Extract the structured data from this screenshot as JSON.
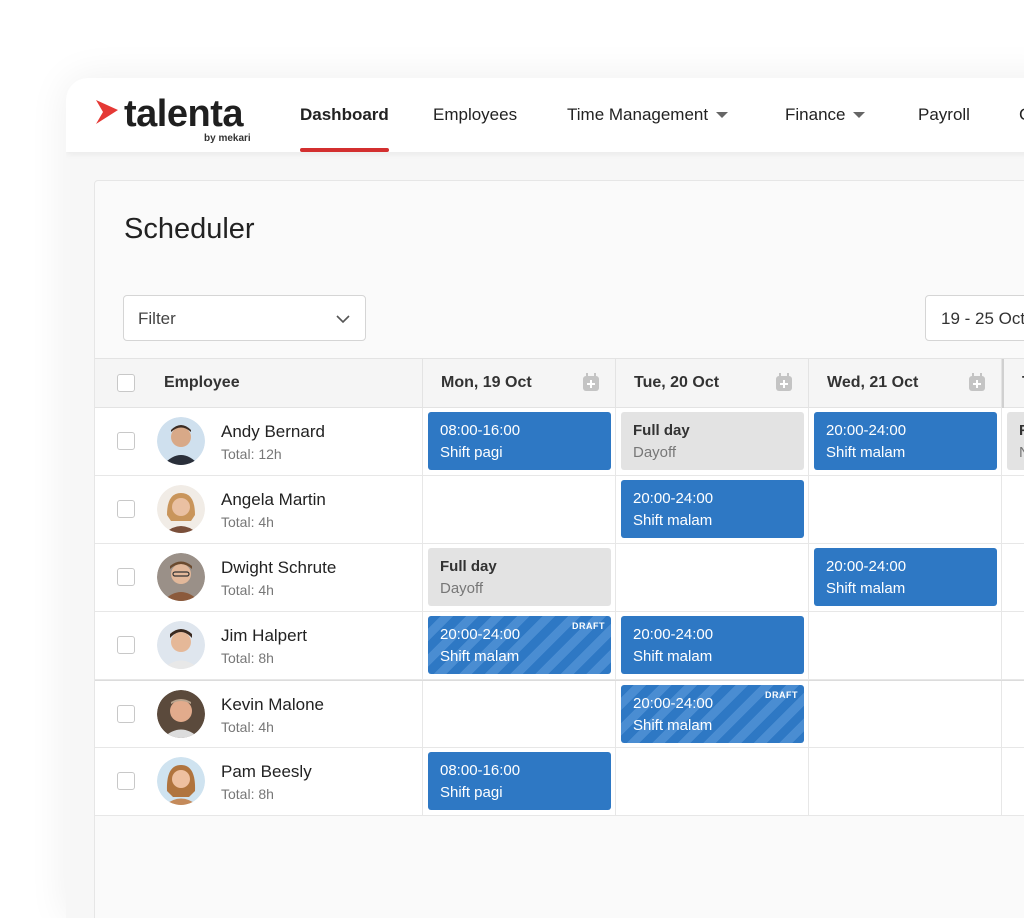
{
  "brand": {
    "name": "talenta",
    "sub": "by mekari",
    "accent": "#d32f2f"
  },
  "nav": {
    "dashboard": "Dashboard",
    "employees": "Employees",
    "time_management": "Time Management",
    "finance": "Finance",
    "payroll": "Payroll",
    "next_partial": "C"
  },
  "page": {
    "title": "Scheduler"
  },
  "filter": {
    "label": "Filter"
  },
  "date_range": {
    "label": "19 - 25 Oct"
  },
  "table": {
    "employee_header": "Employee",
    "days": [
      "Mon, 19 Oct",
      "Tue, 20 Oct",
      "Wed, 21 Oct",
      "T"
    ],
    "rows": [
      {
        "name": "Andy Bernard",
        "total": "Total: 12h",
        "mon": {
          "time": "08:00-16:00",
          "shift": "Shift pagi"
        },
        "tue": {
          "time": "Full day",
          "shift": "Dayoff"
        },
        "wed": {
          "time": "20:00-24:00",
          "shift": "Shift malam"
        },
        "thu": {
          "time": "F",
          "shift": "N"
        }
      },
      {
        "name": "Angela Martin",
        "total": "Total: 4h",
        "tue": {
          "time": "20:00-24:00",
          "shift": "Shift malam"
        }
      },
      {
        "name": "Dwight Schrute",
        "total": "Total: 4h",
        "mon": {
          "time": "Full day",
          "shift": "Dayoff"
        },
        "wed": {
          "time": "20:00-24:00",
          "shift": "Shift malam"
        }
      },
      {
        "name": "Jim Halpert",
        "total": "Total: 8h",
        "mon": {
          "time": "20:00-24:00",
          "shift": "Shift malam",
          "badge": "DRAFT"
        },
        "tue": {
          "time": "20:00-24:00",
          "shift": "Shift malam"
        }
      },
      {
        "name": "Kevin Malone",
        "total": "Total: 4h",
        "tue": {
          "time": "20:00-24:00",
          "shift": "Shift malam",
          "badge": "DRAFT"
        }
      },
      {
        "name": "Pam Beesly",
        "total": "Total: 8h",
        "mon": {
          "time": "08:00-16:00",
          "shift": "Shift pagi"
        }
      }
    ]
  },
  "colors": {
    "shift_blue": "#2e78c4",
    "dayoff_gray": "#e3e3e3",
    "active_tab": "#d32f2f"
  }
}
